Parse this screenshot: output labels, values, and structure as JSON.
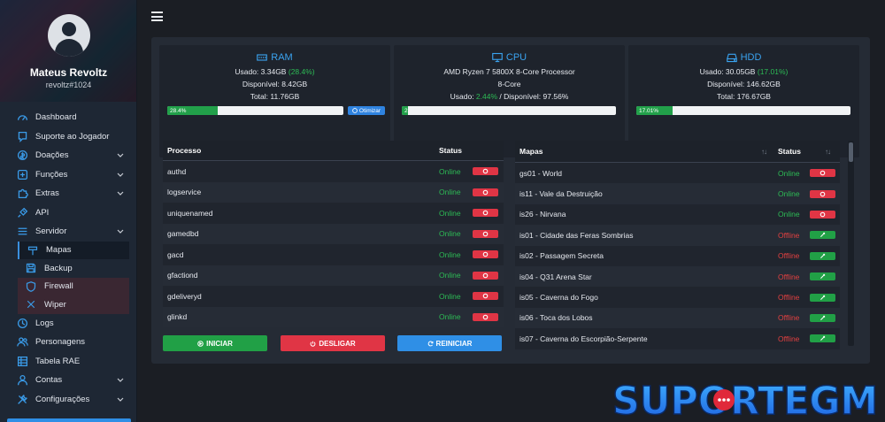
{
  "profile": {
    "name": "Mateus Revoltz",
    "username": "revoltz#1024"
  },
  "nav": {
    "dashboard": "Dashboard",
    "suporte": "Suporte ao Jogador",
    "doacoes": "Doações",
    "funcoes": "Funções",
    "extras": "Extras",
    "api": "API",
    "servidor": "Servidor",
    "mapas": "Mapas",
    "backup": "Backup",
    "firewall": "Firewall",
    "wiper": "Wiper",
    "logs": "Logs",
    "personagens": "Personagens",
    "tabela_rae": "Tabela RAE",
    "contas": "Contas",
    "configuracoes": "Configurações"
  },
  "ram": {
    "title": "RAM",
    "used_label": "Usado: ",
    "used_value": "3.34GB",
    "used_pct": "(28.4%)",
    "available": "Disponível: 8.42GB",
    "total": "Total: 11.76GB",
    "bar_label": "28.4%",
    "bar_fraction": 0.284,
    "optimize_label": "Otimizar"
  },
  "cpu": {
    "title": "CPU",
    "model": "AMD Ryzen 7 5800X 8-Core Processor",
    "cores": "8-Core",
    "used_label": "Usado: ",
    "used_pct": "2.44%",
    "available": " / Disponível: 97.56%",
    "bar_label": "2.",
    "bar_fraction": 0.0244
  },
  "hdd": {
    "title": "HDD",
    "used_label": "Usado: ",
    "used_value": "30.05GB",
    "used_pct": "(17.01%)",
    "available": "Disponível: 146.62GB",
    "total": "Total: 176.67GB",
    "bar_label": "17.01%",
    "bar_fraction": 0.1701
  },
  "processes": {
    "col_process": "Processo",
    "col_status": "Status",
    "rows": [
      {
        "name": "authd",
        "status": "Online"
      },
      {
        "name": "logservice",
        "status": "Online"
      },
      {
        "name": "uniquenamed",
        "status": "Online"
      },
      {
        "name": "gamedbd",
        "status": "Online"
      },
      {
        "name": "gacd",
        "status": "Online"
      },
      {
        "name": "gfactiond",
        "status": "Online"
      },
      {
        "name": "gdeliveryd",
        "status": "Online"
      },
      {
        "name": "glinkd",
        "status": "Online"
      }
    ]
  },
  "actions": {
    "start": "INICIAR",
    "stop": "DESLIGAR",
    "restart": "REINICIAR"
  },
  "maps": {
    "col_maps": "Mapas",
    "col_status": "Status",
    "sort_glyph": "↑↓",
    "rows": [
      {
        "name": "gs01 - World",
        "status": "Online"
      },
      {
        "name": "is11 - Vale da Destruição",
        "status": "Online"
      },
      {
        "name": "is26 - Nirvana",
        "status": "Online"
      },
      {
        "name": "is01 - Cidade das Feras Sombrias",
        "status": "Offline"
      },
      {
        "name": "is02 - Passagem Secreta",
        "status": "Offline"
      },
      {
        "name": "is04 - Q31 Arena Star",
        "status": "Offline"
      },
      {
        "name": "is05 - Caverna do Fogo",
        "status": "Offline"
      },
      {
        "name": "is06 - Toca dos Lobos",
        "status": "Offline"
      },
      {
        "name": "is07 - Caverna do Escorpião-Serpente",
        "status": "Offline"
      }
    ]
  },
  "colors": {
    "accent": "#3aa3f0",
    "online": "#2dbb55",
    "offline": "#e04040",
    "green_btn": "#21a046",
    "red_btn": "#e03545",
    "blue_btn": "#2f8fe6"
  },
  "watermark": "SUPORTEGM"
}
